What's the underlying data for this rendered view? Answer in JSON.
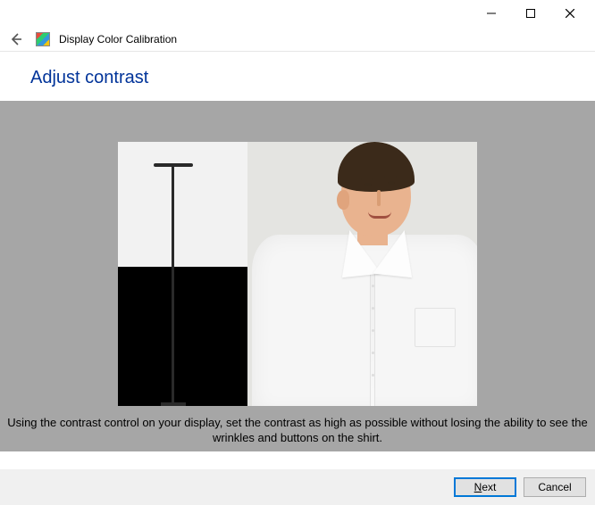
{
  "window": {
    "title": "Display Color Calibration"
  },
  "page": {
    "heading": "Adjust contrast",
    "instruction": "Using the contrast control on your display, set the contrast as high as possible without losing the ability to see the wrinkles and buttons on the shirt."
  },
  "buttons": {
    "next": "Next",
    "cancel": "Cancel"
  },
  "icons": {
    "back": "back-arrow-icon",
    "minimize": "minimize-icon",
    "maximize": "maximize-icon",
    "close": "close-icon",
    "app": "color-calibration-icon"
  }
}
